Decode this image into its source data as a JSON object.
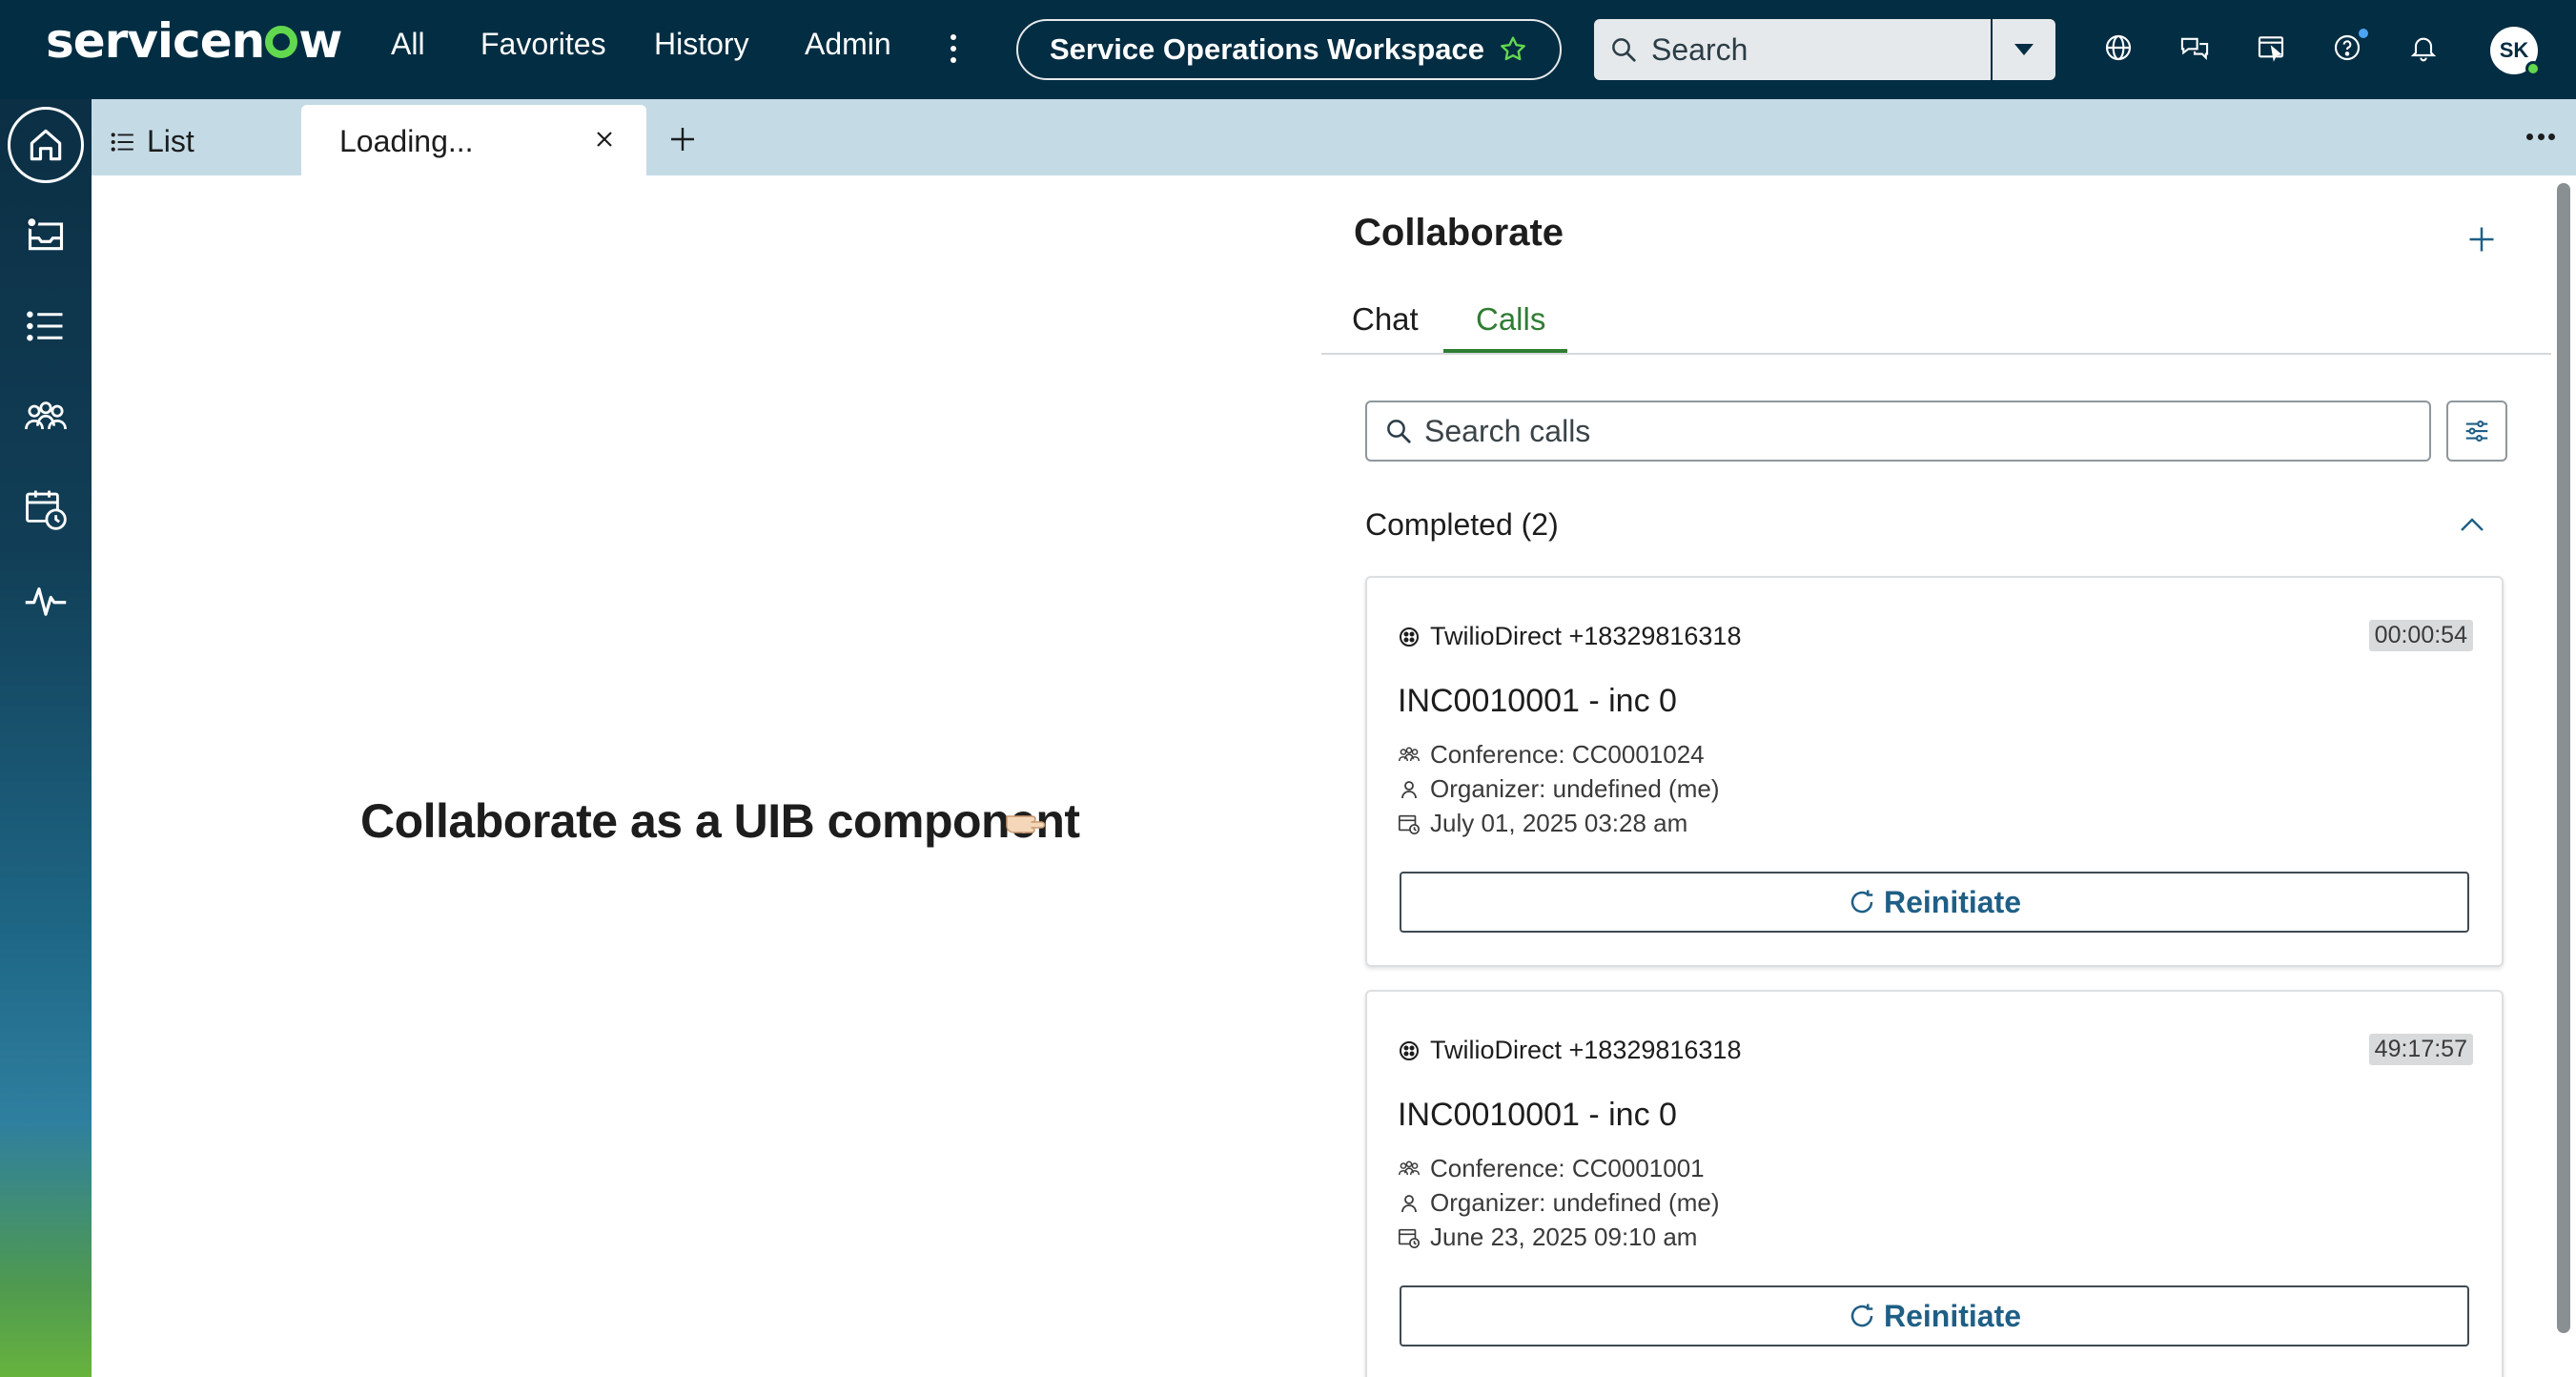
{
  "header": {
    "logo_text_a": "servicen",
    "logo_text_b": "w",
    "nav": [
      "All",
      "Favorites",
      "History",
      "Admin"
    ],
    "workspace_label": "Service Operations Workspace",
    "search_placeholder": "Search",
    "avatar_initials": "SK",
    "icons": [
      "globe-icon",
      "chat-icon",
      "workspace-icon",
      "help-icon",
      "bell-icon"
    ]
  },
  "rail": {
    "items": [
      "home-icon",
      "inbox-icon",
      "list-icon",
      "people-icon",
      "calendar-clock-icon",
      "pulse-icon"
    ]
  },
  "tabs": {
    "list_label": "List",
    "active_label": "Loading..."
  },
  "main": {
    "uib_text": "Collaborate as a UIB component"
  },
  "collaborate": {
    "title": "Collaborate",
    "tabs": [
      "Chat",
      "Calls"
    ],
    "active_tab": "Calls",
    "search_placeholder": "Search calls",
    "group_title": "Completed (2)",
    "calls": [
      {
        "provider": "TwilioDirect +18329816318",
        "duration": "00:00:54",
        "title": "INC0010001 - inc 0",
        "conference": "Conference: CC0001024",
        "organizer": "Organizer: undefined (me)",
        "date": "July 01, 2025 03:28 am",
        "action": "Reinitiate"
      },
      {
        "provider": "TwilioDirect +18329816318",
        "duration": "49:17:57",
        "title": "INC0010001 - inc 0",
        "conference": "Conference: CC0001001",
        "organizer": "Organizer: undefined (me)",
        "date": "June 23, 2025 09:10 am",
        "action": "Reinitiate"
      }
    ]
  },
  "colors": {
    "header_bg": "#032d42",
    "tabstrip_bg": "#c4dbe6",
    "accent_green": "#2e7d32",
    "logo_green": "#62d84e",
    "action_blue": "#1f5f86"
  }
}
